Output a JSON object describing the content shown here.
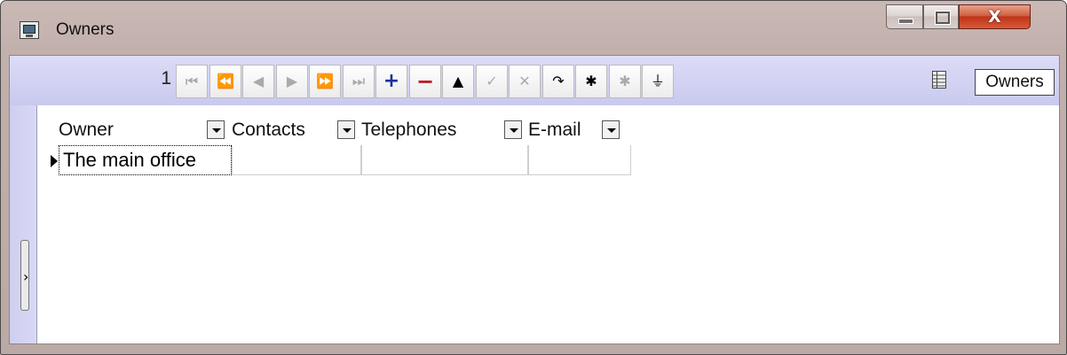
{
  "window": {
    "title": "Owners",
    "icon": "monitor-app-icon",
    "controls": [
      "minimize-icon",
      "maximize-icon",
      "close-icon"
    ],
    "close_glyph": "X"
  },
  "navigator": {
    "record_number": "1",
    "buttons": [
      {
        "name": "first-record-button",
        "icon": "first-record-icon",
        "glyph": "⏮",
        "enabled": false
      },
      {
        "name": "prior-page-button",
        "icon": "prior-page-icon",
        "glyph": "⏪",
        "enabled": false
      },
      {
        "name": "prior-record-button",
        "icon": "prior-record-icon",
        "glyph": "◀",
        "enabled": false
      },
      {
        "name": "next-record-button",
        "icon": "next-record-icon",
        "glyph": "▶",
        "enabled": false
      },
      {
        "name": "next-page-button",
        "icon": "next-page-icon",
        "glyph": "⏩",
        "enabled": false
      },
      {
        "name": "last-record-button",
        "icon": "last-record-icon",
        "glyph": "⏭",
        "enabled": false
      },
      {
        "name": "insert-record-button",
        "icon": "plus-icon",
        "glyph": "+",
        "enabled": true
      },
      {
        "name": "delete-record-button",
        "icon": "minus-icon",
        "glyph": "−",
        "enabled": true
      },
      {
        "name": "edit-record-button",
        "icon": "up-triangle-icon",
        "glyph": "▲",
        "enabled": true
      },
      {
        "name": "post-record-button",
        "icon": "checkmark-icon",
        "glyph": "✓",
        "enabled": false
      },
      {
        "name": "cancel-edit-button",
        "icon": "cross-icon",
        "glyph": "✕",
        "enabled": false
      },
      {
        "name": "refresh-button",
        "icon": "refresh-icon",
        "glyph": "↷",
        "enabled": true
      },
      {
        "name": "apply-updates-button",
        "icon": "asterisk-icon",
        "glyph": "✱",
        "enabled": true
      },
      {
        "name": "cancel-updates-button",
        "icon": "asterisk-arrow-icon",
        "glyph": "✱",
        "enabled": false
      },
      {
        "name": "filter-button",
        "icon": "funnel-icon",
        "glyph": "⏚",
        "enabled": true
      }
    ],
    "grid_icon": "grid-view-icon",
    "caption": "Owners"
  },
  "table": {
    "columns": [
      "Owner",
      "Contacts",
      "Telephones",
      "E-mail"
    ],
    "rows": [
      [
        "The main office",
        "",
        "",
        ""
      ]
    ]
  },
  "sidebar": {
    "expand_icon": "expand-arrow-icon",
    "arrow": "›"
  },
  "colors": {
    "navbar": "#d2d2f3",
    "close_button": "#c74a2a",
    "title_bar": "#c4b2ae"
  }
}
